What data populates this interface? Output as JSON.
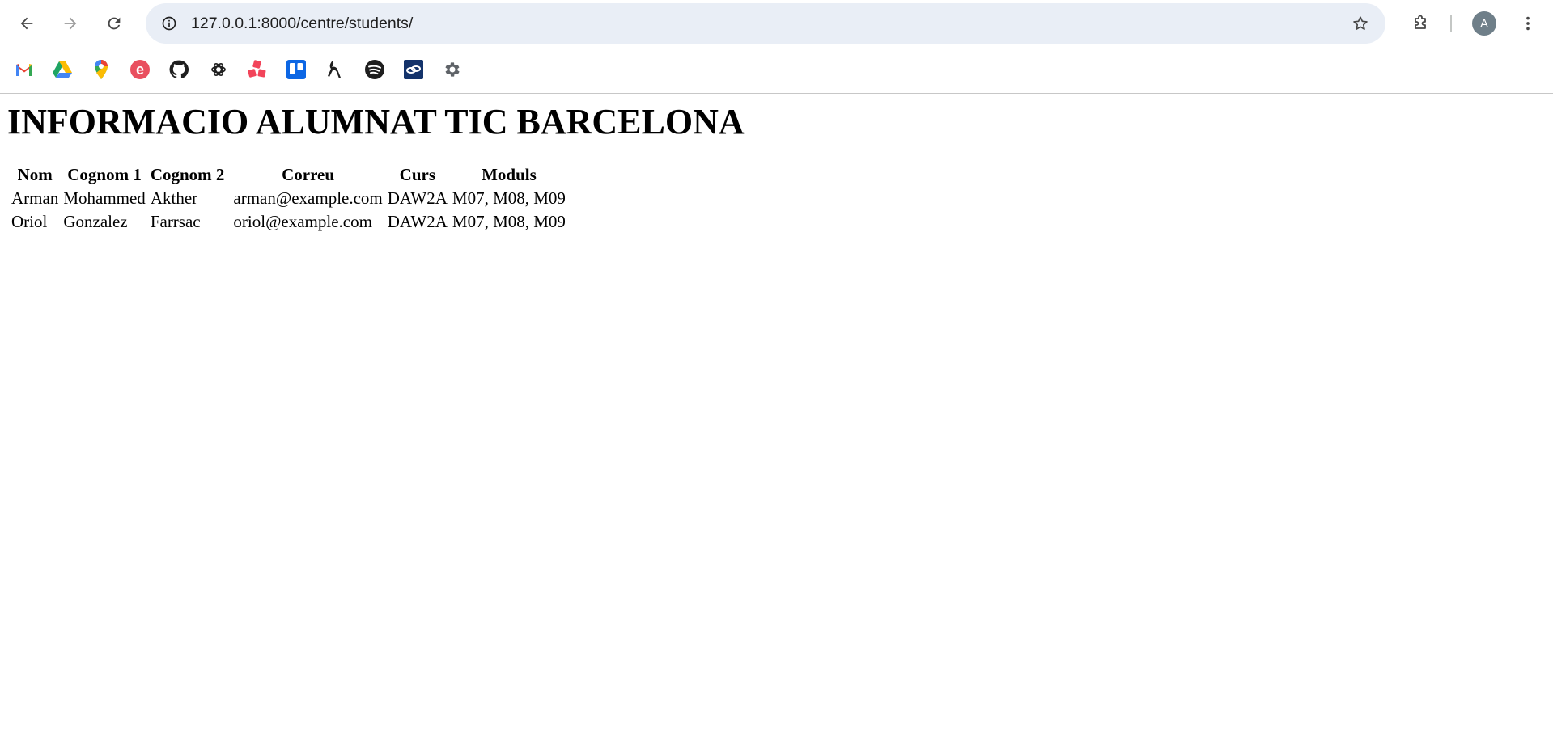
{
  "browser": {
    "url": "127.0.0.1:8000/centre/students/",
    "profile_initial": "A",
    "bookmarks": [
      {
        "icon": "gmail-icon"
      },
      {
        "icon": "google-drive-icon"
      },
      {
        "icon": "google-maps-icon"
      },
      {
        "icon": "e-icon"
      },
      {
        "icon": "github-icon"
      },
      {
        "icon": "openai-icon"
      },
      {
        "icon": "asana-icon"
      },
      {
        "icon": "trello-icon"
      },
      {
        "icon": "bookmark-app-icon"
      },
      {
        "icon": "spotify-icon"
      },
      {
        "icon": "link-app-icon"
      },
      {
        "icon": "settings-gear-icon"
      }
    ]
  },
  "page": {
    "title": "INFORMACIO ALUMNAT TIC BARCELONA",
    "table": {
      "headers": [
        "Nom",
        "Cognom 1",
        "Cognom 2",
        "Correu",
        "Curs",
        "Moduls"
      ],
      "rows": [
        [
          "Arman",
          "Mohammed",
          "Akther",
          "arman@example.com",
          "DAW2A",
          "M07, M08, M09"
        ],
        [
          "Oriol",
          "Gonzalez",
          "Farrsac",
          "oriol@example.com",
          "DAW2A",
          "M07, M08, M09"
        ]
      ]
    }
  }
}
